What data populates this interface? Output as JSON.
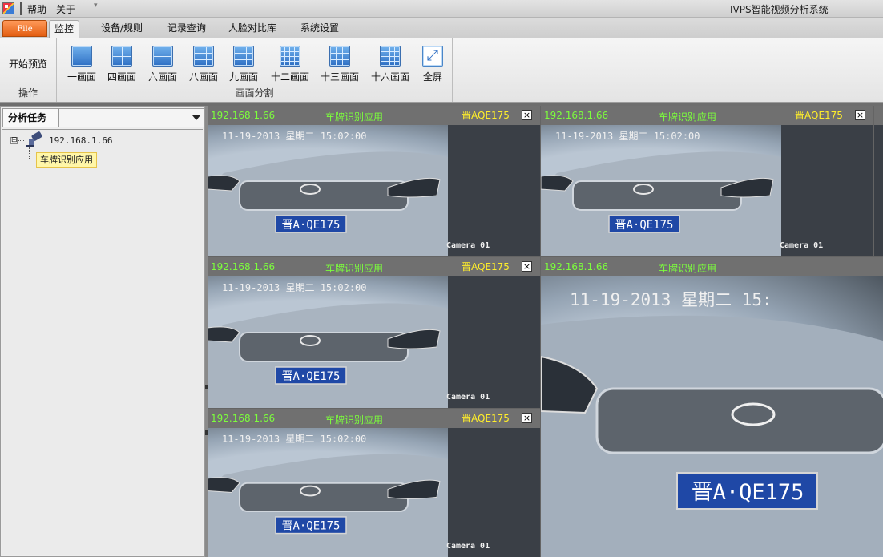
{
  "titlebar": {
    "menu_help": "帮助",
    "menu_about": "关于",
    "app_title": "IVPS智能视频分析系统"
  },
  "tabs": {
    "file": "File",
    "items": [
      "监控",
      "设备/规则",
      "记录查询",
      "人脸对比库",
      "系统设置"
    ],
    "active": "监控"
  },
  "ribbon": {
    "operate_group": {
      "start_preview": "开始预览",
      "title": "操作"
    },
    "split_group": {
      "title": "画面分割",
      "buttons": [
        "一画面",
        "四画面",
        "六画面",
        "八画面",
        "九画面",
        "十二画面",
        "十三画面",
        "十六画面",
        "全屏"
      ]
    }
  },
  "left_panel": {
    "tab_label": "分析任务",
    "tree": {
      "expand_symbol": "⊟",
      "device_ip": "192.168.1.66",
      "app_node": "车牌识别应用"
    }
  },
  "videos": [
    {
      "ip": "192.168.1.66",
      "app": "车牌识别应用",
      "plate": "晋AQE175",
      "close": "×",
      "timestamp": "11-19-2013 星期二 15:02:00",
      "camera": "Camera 01",
      "plate_img": "晋A·QE175"
    },
    {
      "ip": "192.168.1.66",
      "app": "车牌识别应用",
      "plate": "晋AQE175",
      "close": "×",
      "timestamp": "11-19-2013 星期二 15:02:00",
      "camera": "Camera 01",
      "plate_img": "晋A·QE175"
    },
    {
      "ip": "192.168.1.66",
      "app": "车牌识别应用",
      "plate": "晋AQE175",
      "close": "×",
      "timestamp": "11-19-2013 星期二 15:02:00",
      "camera": "Camera 01",
      "plate_img": "晋A·QE175"
    },
    {
      "ip": "192.168.1.66",
      "app": "车牌识别应用",
      "plate": "晋AQE175",
      "close": "×",
      "timestamp": "11-19-2013 星期二 15:02:00",
      "camera": "Camera 01",
      "plate_img": "晋A·QE175"
    },
    {
      "ip": "192.168.1.66",
      "app": "车牌识别应用",
      "timestamp": "11-19-2013 星期二 15:",
      "plate_img": "晋A·QE175"
    }
  ],
  "colors": {
    "file_button": "#f07a2a",
    "ip_text": "#7cff3c",
    "plate_text": "#ffee2a",
    "tree_highlight": "#fff6a8"
  }
}
